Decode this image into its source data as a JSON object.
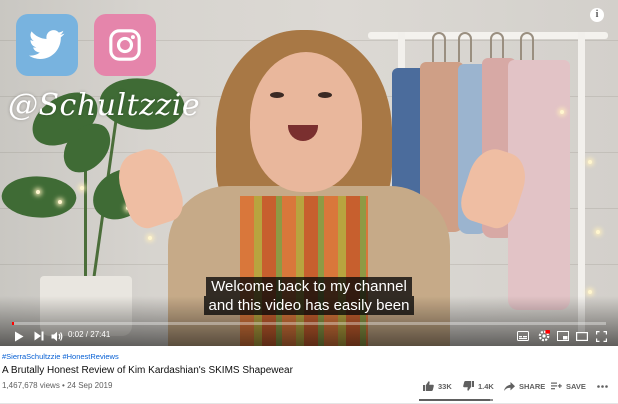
{
  "overlay": {
    "twitter_icon": "twitter-bird-icon",
    "instagram_icon": "instagram-camera-icon",
    "handle": "@Schultzzie",
    "info_glyph": "i"
  },
  "caption": {
    "line1": "Welcome back to my channel",
    "line2": "and this video has easily been"
  },
  "player": {
    "current_time": "0:02",
    "duration": "27:41",
    "time_separator": " / ",
    "progress_fraction": 0.0012,
    "controls": [
      "play-icon",
      "next-icon",
      "volume-icon",
      "subtitles-icon",
      "settings-icon",
      "miniplayer-icon",
      "theater-icon",
      "fullscreen-icon"
    ],
    "accent_color": "#ff0000"
  },
  "video": {
    "hashtags": "#SierraSchultzzie #HonestReviews",
    "title": "A Brutally Honest Review of Kim Kardashian's SKIMS Shapewear",
    "views": "1,467,678 views",
    "date": "24 Sep 2019",
    "meta_separator": " • "
  },
  "actions": {
    "likes": "33K",
    "dislikes": "1.4K",
    "share": "SHARE",
    "save": "SAVE",
    "like_ratio": 0.96
  }
}
